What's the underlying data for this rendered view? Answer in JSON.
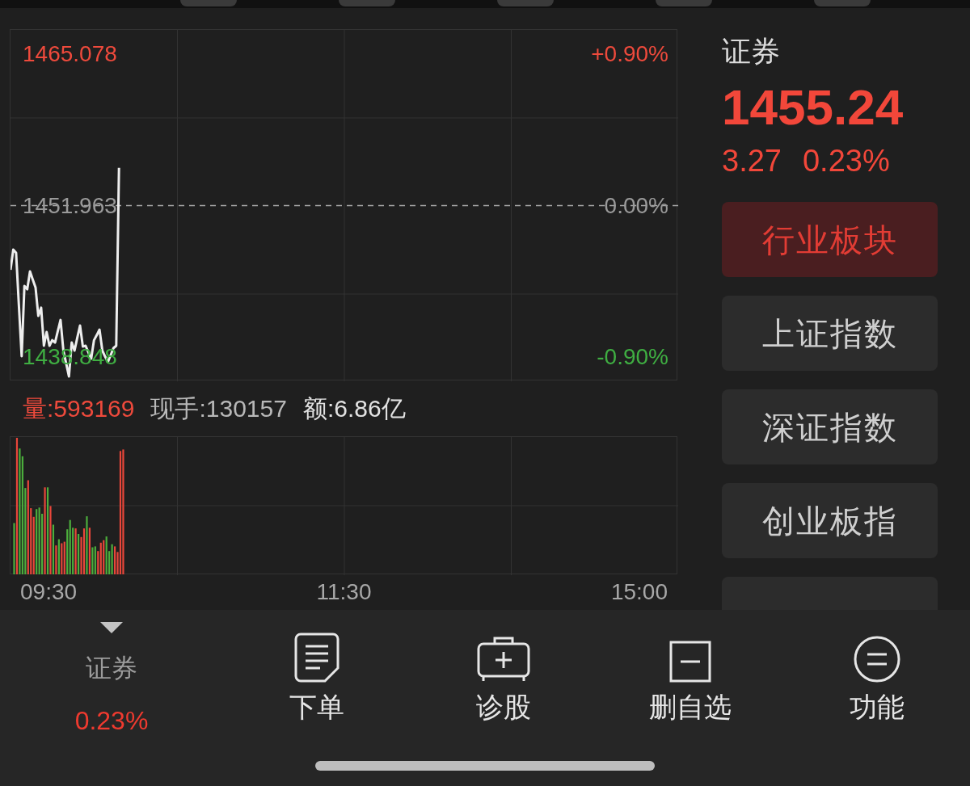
{
  "price_chart": {
    "chart_data": {
      "type": "line",
      "categories": [
        null,
        null,
        null,
        null,
        null,
        null,
        null,
        null,
        null,
        null,
        null,
        null,
        null,
        null,
        null,
        null,
        null,
        null,
        null,
        null,
        null,
        null,
        null,
        null,
        null,
        null,
        null,
        null,
        null,
        null,
        null,
        null,
        null,
        null,
        null,
        null,
        null,
        null,
        null,
        null,
        null,
        null,
        null,
        null,
        null,
        null,
        null,
        null,
        null,
        null,
        null,
        null,
        null,
        null,
        null,
        null,
        null,
        null,
        null,
        null,
        null,
        null,
        null,
        null,
        null,
        null,
        null,
        null,
        null,
        null,
        null,
        null,
        null,
        null,
        null,
        null,
        null,
        null,
        null,
        null,
        null,
        null,
        null,
        null,
        null,
        null,
        null,
        null,
        null,
        null,
        null,
        null,
        null,
        null,
        null,
        null,
        null,
        null,
        null,
        null,
        null,
        null,
        null,
        null,
        null,
        null,
        null,
        null,
        null,
        null,
        null,
        null,
        null,
        null,
        null,
        null,
        null,
        null,
        null,
        null,
        null,
        null,
        null,
        null,
        null,
        null,
        null,
        null,
        null,
        null,
        null,
        null,
        null,
        null,
        null,
        null,
        null,
        null,
        null,
        null,
        null,
        null,
        null,
        null,
        null,
        null,
        null,
        null,
        null,
        null,
        null,
        null,
        null,
        null,
        null,
        null,
        null,
        null,
        null,
        null,
        null,
        null,
        null,
        null,
        null,
        null,
        null,
        null,
        null,
        null,
        null,
        null,
        null,
        null,
        null,
        null,
        null,
        null,
        null,
        null,
        null,
        null,
        null,
        null,
        null,
        null,
        null,
        null,
        null,
        null,
        null,
        null,
        null,
        null,
        null,
        null,
        null,
        null,
        null,
        null,
        null,
        null,
        null,
        null,
        null,
        null,
        null,
        null,
        null,
        null,
        null,
        null,
        null,
        null,
        null,
        null,
        null,
        null,
        null,
        null,
        null,
        null,
        null,
        null,
        null,
        null,
        null,
        null,
        null,
        null,
        null,
        null,
        null,
        null,
        null,
        null,
        null,
        null,
        null,
        null,
        null
      ],
      "values": [
        1446.4,
        1448.15,
        1447.88,
        1443.4,
        1438.92,
        1445.0,
        1444.72,
        1446.26,
        1445.57,
        1444.86,
        1442.41,
        1443.12,
        1439.83,
        1441.02,
        1439.83,
        1440.31,
        1440.1,
        1441.1,
        1442.06,
        1439.41,
        1438.32,
        1437.17,
        1440.1,
        1439.41,
        1440.52,
        1441.58,
        1439.76,
        1439.83,
        1439.25,
        1438.71,
        1440.31,
        1440.75,
        1441.23,
        1439.41,
        1438.9,
        1438.43,
        1439.01,
        1439.62,
        1439.83,
        1455.24,
        null,
        null,
        null,
        null,
        null,
        null,
        null,
        null,
        null,
        null,
        null,
        null,
        null,
        null,
        null,
        null,
        null,
        null,
        null,
        null,
        null,
        null,
        null,
        null,
        null,
        null,
        null,
        null,
        null,
        null,
        null,
        null,
        null,
        null,
        null,
        null,
        null,
        null,
        null,
        null,
        null,
        null,
        null,
        null,
        null,
        null,
        null,
        null,
        null,
        null,
        null,
        null,
        null,
        null,
        null,
        null,
        null,
        null,
        null,
        null,
        null,
        null,
        null,
        null,
        null,
        null,
        null,
        null,
        null,
        null,
        null,
        null,
        null,
        null,
        null,
        null,
        null,
        null,
        null,
        null,
        null,
        null,
        null,
        null,
        null,
        null,
        null,
        null,
        null,
        null,
        null,
        null,
        null,
        null,
        null,
        null,
        null,
        null,
        null,
        null,
        null,
        null,
        null,
        null,
        null,
        null,
        null,
        null,
        null,
        null,
        null,
        null,
        null,
        null,
        null,
        null,
        null,
        null,
        null,
        null,
        null,
        null,
        null,
        null,
        null,
        null,
        null,
        null,
        null,
        null,
        null,
        null,
        null,
        null,
        null,
        null,
        null,
        null,
        null,
        null,
        null,
        null,
        null,
        null,
        null,
        null,
        null,
        null,
        null,
        null,
        null,
        null,
        null,
        null,
        null,
        null,
        null,
        null,
        null,
        null,
        null,
        null,
        null,
        null,
        null,
        null,
        null,
        null,
        null,
        null,
        null,
        null,
        null,
        null,
        null,
        null,
        null,
        null,
        null,
        null,
        null,
        null,
        null,
        null,
        null,
        null,
        null,
        null,
        null,
        null,
        null,
        null,
        null,
        null,
        null,
        null,
        null,
        null,
        null,
        null,
        null
      ],
      "ylim": [
        1436.75,
        1467.18
      ],
      "yticks": [
        {
          "value": 1465.078,
          "label": "1465.078"
        },
        {
          "value": 1451.963,
          "label": "1451.963"
        },
        {
          "value": 1438.848,
          "label": "1438.848"
        }
      ],
      "ref_lines": [
        {
          "axis": "y",
          "value": 1451.963
        }
      ]
    },
    "change_labels": [
      {
        "text": "+0.90%",
        "kind": "up"
      },
      {
        "text": "0.00%",
        "kind": "flat"
      },
      {
        "text": "-0.90%",
        "kind": "down"
      }
    ]
  },
  "volume_summary": [
    {
      "text": "量:593169",
      "kind": "volume"
    },
    {
      "text": "现手:130157",
      "kind": "hand"
    },
    {
      "text": "额:6.86亿",
      "kind": "amount"
    }
  ],
  "time_axis": [
    "09:30",
    "11:30",
    "15:00"
  ],
  "quote": {
    "name": "证券",
    "price": "1455.24",
    "change": "3.27",
    "change_pct": "0.23%"
  },
  "side_buttons": [
    {
      "label": "行业板块",
      "selected": true
    },
    {
      "label": "上证指数",
      "selected": false
    },
    {
      "label": "深证指数",
      "selected": false
    },
    {
      "label": "创业板指",
      "selected": false
    },
    {
      "selected": false
    }
  ],
  "bottom_bar": {
    "instrument": {
      "name": "证券",
      "change_pct": "0.23%"
    },
    "actions": [
      {
        "label": "下单",
        "kind": "order"
      },
      {
        "label": "诊股",
        "kind": "diagnose"
      },
      {
        "label": "删自选",
        "kind": "remove"
      },
      {
        "label": "功能",
        "kind": "menu"
      }
    ]
  }
}
